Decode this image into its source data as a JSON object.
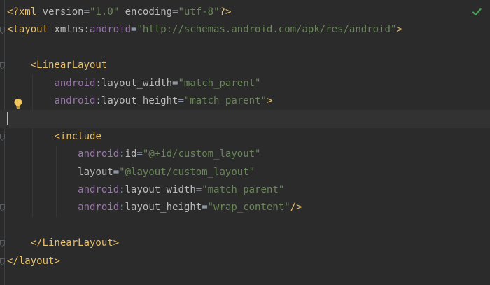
{
  "editor": {
    "lines": [
      [
        "<?xml version=\"1.0\" encoding=\"utf-8\"?>"
      ],
      [
        "<layout xmlns:android=\"http://schemas.android.com/apk/res/android\">"
      ],
      [
        ""
      ],
      [
        "    <LinearLayout"
      ],
      [
        "        android:layout_width=\"match_parent\""
      ],
      [
        "        android:layout_height=\"match_parent\">"
      ],
      [
        ""
      ],
      [
        "        <include"
      ],
      [
        "            android:id=\"@+id/custom_layout\""
      ],
      [
        "            layout=\"@layout/custom_layout\""
      ],
      [
        "            android:layout_width=\"match_parent\""
      ],
      [
        "            android:layout_height=\"wrap_content\"/>"
      ],
      [
        ""
      ],
      [
        "    </LinearLayout>"
      ],
      [
        "</layout>"
      ]
    ],
    "segments": {
      "l0": [
        {
          "t": "<?",
          "c": "tag"
        },
        {
          "t": "xml ",
          "c": "tag"
        },
        {
          "t": "version",
          "c": "attr"
        },
        {
          "t": "=",
          "c": "plain"
        },
        {
          "t": "\"1.0\"",
          "c": "val"
        },
        {
          "t": " ",
          "c": "plain"
        },
        {
          "t": "encoding",
          "c": "attr"
        },
        {
          "t": "=",
          "c": "plain"
        },
        {
          "t": "\"utf-8\"",
          "c": "val"
        },
        {
          "t": "?>",
          "c": "tag"
        }
      ],
      "l1": [
        {
          "t": "<layout ",
          "c": "tag"
        },
        {
          "t": "xmlns",
          "c": "attr"
        },
        {
          "t": ":",
          "c": "plain"
        },
        {
          "t": "android",
          "c": "ns"
        },
        {
          "t": "=",
          "c": "plain"
        },
        {
          "t": "\"http://schemas.android.com/apk/res/android\"",
          "c": "val"
        },
        {
          "t": ">",
          "c": "tag"
        }
      ],
      "l3": [
        {
          "t": "    ",
          "c": "plain"
        },
        {
          "t": "<LinearLayout",
          "c": "tag"
        }
      ],
      "l4": [
        {
          "t": "        ",
          "c": "plain"
        },
        {
          "t": "android",
          "c": "ns"
        },
        {
          "t": ":",
          "c": "plain"
        },
        {
          "t": "layout_width",
          "c": "attr"
        },
        {
          "t": "=",
          "c": "plain"
        },
        {
          "t": "\"match_parent\"",
          "c": "val"
        }
      ],
      "l5": [
        {
          "t": "        ",
          "c": "plain"
        },
        {
          "t": "android",
          "c": "ns"
        },
        {
          "t": ":",
          "c": "plain"
        },
        {
          "t": "layout_height",
          "c": "attr"
        },
        {
          "t": "=",
          "c": "plain"
        },
        {
          "t": "\"match_parent\"",
          "c": "val"
        },
        {
          "t": ">",
          "c": "tag"
        }
      ],
      "l7": [
        {
          "t": "        ",
          "c": "plain"
        },
        {
          "t": "<include",
          "c": "tag"
        }
      ],
      "l8": [
        {
          "t": "            ",
          "c": "plain"
        },
        {
          "t": "android",
          "c": "ns"
        },
        {
          "t": ":",
          "c": "plain"
        },
        {
          "t": "id",
          "c": "attr"
        },
        {
          "t": "=",
          "c": "plain"
        },
        {
          "t": "\"@+id/custom_layout\"",
          "c": "val"
        }
      ],
      "l9": [
        {
          "t": "            ",
          "c": "plain"
        },
        {
          "t": "layout",
          "c": "attr"
        },
        {
          "t": "=",
          "c": "plain"
        },
        {
          "t": "\"@layout/custom_layout\"",
          "c": "val"
        }
      ],
      "l10": [
        {
          "t": "            ",
          "c": "plain"
        },
        {
          "t": "android",
          "c": "ns"
        },
        {
          "t": ":",
          "c": "plain"
        },
        {
          "t": "layout_width",
          "c": "attr"
        },
        {
          "t": "=",
          "c": "plain"
        },
        {
          "t": "\"match_parent\"",
          "c": "val"
        }
      ],
      "l11": [
        {
          "t": "            ",
          "c": "plain"
        },
        {
          "t": "android",
          "c": "ns"
        },
        {
          "t": ":",
          "c": "plain"
        },
        {
          "t": "layout_height",
          "c": "attr"
        },
        {
          "t": "=",
          "c": "plain"
        },
        {
          "t": "\"wrap_content\"",
          "c": "val"
        },
        {
          "t": "/>",
          "c": "tag"
        }
      ],
      "l13": [
        {
          "t": "    ",
          "c": "plain"
        },
        {
          "t": "</LinearLayout>",
          "c": "tag"
        }
      ],
      "l14": [
        {
          "t": "</layout>",
          "c": "tag"
        }
      ]
    },
    "colors": {
      "background": "#2b2b2b",
      "current_line": "#323232",
      "tag": "#e8bf6a",
      "attribute": "#bababa",
      "namespace": "#9876aa",
      "value": "#6a8759",
      "plain": "#a9b7c6",
      "check": "#499c54",
      "bulb": "#f2c55c"
    },
    "icons": {
      "status": "check-icon",
      "intention": "lightbulb-icon",
      "fold": "fold-marker-icon"
    },
    "current_line_index": 6
  }
}
